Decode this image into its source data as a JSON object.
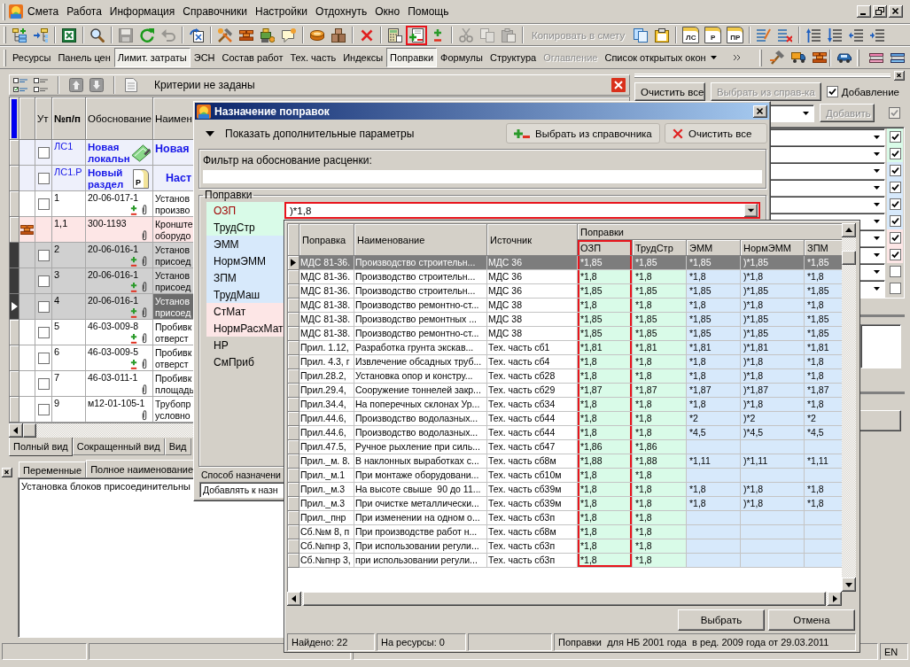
{
  "menu": {
    "items": [
      "Смета",
      "Работа",
      "Информация",
      "Справочники",
      "Настройки",
      "Отдохнуть",
      "Окно",
      "Помощь"
    ]
  },
  "toolbar": [
    [
      {
        "kind": "icon",
        "disabled": false,
        "highlighted": false
      },
      {
        "kind": "icon",
        "disabled": false,
        "highlighted": false
      }
    ],
    [
      {
        "kind": "icon",
        "disabled": false,
        "highlighted": false
      }
    ],
    [
      {
        "kind": "icon",
        "disabled": false,
        "highlighted": false
      }
    ],
    [
      {
        "kind": "icon",
        "disabled": true,
        "highlighted": false
      },
      {
        "kind": "icon",
        "disabled": false,
        "highlighted": false
      },
      {
        "kind": "icon",
        "disabled": true,
        "highlighted": false
      }
    ],
    [
      {
        "kind": "icon",
        "disabled": false,
        "highlighted": false
      }
    ],
    [
      {
        "kind": "icon",
        "disabled": false,
        "highlighted": false
      },
      {
        "kind": "icon",
        "disabled": false,
        "highlighted": false
      },
      {
        "kind": "icon",
        "disabled": false,
        "highlighted": false
      },
      {
        "kind": "icon",
        "disabled": false,
        "highlighted": false
      }
    ],
    [
      {
        "kind": "icon",
        "disabled": false,
        "highlighted": false
      },
      {
        "kind": "icon",
        "disabled": false,
        "highlighted": false
      }
    ],
    [
      {
        "kind": "icon",
        "disabled": false,
        "highlighted": false
      }
    ],
    [
      {
        "kind": "icon",
        "disabled": false,
        "highlighted": false
      },
      {
        "kind": "icon",
        "disabled": false,
        "highlighted": true
      },
      {
        "kind": "icon",
        "disabled": false,
        "highlighted": false
      }
    ],
    [
      {
        "kind": "icon",
        "disabled": true,
        "highlighted": false
      },
      {
        "kind": "icon",
        "disabled": true,
        "highlighted": false
      },
      {
        "kind": "icon",
        "disabled": true,
        "highlighted": false
      }
    ],
    [
      {
        "kind": "text",
        "label": "Копировать в смету",
        "disabled": true,
        "highlighted": false
      },
      {
        "kind": "icon",
        "disabled": false,
        "highlighted": false
      },
      {
        "kind": "icon",
        "disabled": false,
        "highlighted": false
      }
    ],
    [
      {
        "kind": "form",
        "label": "ЛС",
        "disabled": false,
        "highlighted": false
      },
      {
        "kind": "form",
        "label": "Р",
        "disabled": false,
        "highlighted": false
      },
      {
        "kind": "form",
        "label": "ПР",
        "disabled": false,
        "highlighted": false
      }
    ],
    [
      {
        "kind": "icon",
        "disabled": false,
        "highlighted": false
      },
      {
        "kind": "icon",
        "disabled": false,
        "highlighted": false
      }
    ],
    [
      {
        "kind": "icon",
        "disabled": false,
        "highlighted": false
      },
      {
        "kind": "icon",
        "disabled": false,
        "highlighted": false
      },
      {
        "kind": "icon",
        "disabled": false,
        "highlighted": false
      },
      {
        "kind": "icon",
        "disabled": false,
        "highlighted": false
      }
    ]
  ],
  "panel_tabs": [
    {
      "kind": "toggle",
      "label": "Ресурсы",
      "selected": false,
      "disabled": false
    },
    {
      "kind": "toggle",
      "label": "Панель цен",
      "selected": false,
      "disabled": false
    },
    {
      "kind": "toggle",
      "label": "Лимит. затраты",
      "selected": true,
      "disabled": false
    },
    {
      "kind": "toggle",
      "label": "ЭСН",
      "selected": false,
      "disabled": false
    },
    {
      "kind": "toggle",
      "label": "Состав работ",
      "selected": false,
      "disabled": false
    },
    {
      "kind": "toggle",
      "label": "Тех. часть",
      "selected": false,
      "disabled": false
    },
    {
      "kind": "toggle",
      "label": "Индексы",
      "selected": false,
      "disabled": false
    },
    {
      "kind": "toggle",
      "label": "Поправки",
      "selected": true,
      "disabled": false
    },
    {
      "kind": "toggle",
      "label": "Формулы",
      "selected": false,
      "disabled": false
    },
    {
      "kind": "toggle",
      "label": "Структура",
      "selected": false,
      "disabled": false
    },
    {
      "kind": "toggle",
      "label": "Оглавление",
      "selected": false,
      "disabled": true
    },
    {
      "kind": "menu",
      "label": "Список открытых окон",
      "selected": false,
      "disabled": false
    }
  ],
  "estimate": {
    "filter_status": "Критерии не заданы",
    "move_buttons": [
      {
        "disabled": true
      },
      {
        "disabled": true
      }
    ],
    "columns": [
      "Ут",
      "№п/п",
      "Обоснование",
      "Наимен"
    ],
    "rows": [
      {
        "kind": "estimate",
        "number": "ЛС1",
        "code": "Новая локальн",
        "name": "Новая",
        "checked": false,
        "selected": false,
        "current": false
      },
      {
        "kind": "section",
        "number": "ЛС1.Р",
        "code": "Новый раздел",
        "badge": "Р",
        "name": "Наст",
        "checked": false,
        "selected": false,
        "current": false
      },
      {
        "kind": "item",
        "number": "1",
        "code": "20-06-017-1",
        "name": "Установ произво",
        "checked": false,
        "has_adjustments": true,
        "selected": false,
        "current": false
      },
      {
        "kind": "resource",
        "number": "1,1",
        "code": "300-1193",
        "name": "Кронште оборудо",
        "has_adjustments": false,
        "selected": false,
        "current": false
      },
      {
        "kind": "item",
        "number": "2",
        "code": "20-06-016-1",
        "name": "Установ присоед",
        "checked": false,
        "has_adjustments": true,
        "selected": true,
        "current": false
      },
      {
        "kind": "item",
        "number": "3",
        "code": "20-06-016-1",
        "name": "Установ присоед",
        "checked": false,
        "has_adjustments": true,
        "selected": true,
        "current": false
      },
      {
        "kind": "item",
        "number": "4",
        "code": "20-06-016-1",
        "name": "Установ присоед",
        "checked": false,
        "has_adjustments": true,
        "selected": true,
        "current": true
      },
      {
        "kind": "item",
        "number": "5",
        "code": "46-03-009-8",
        "name": "Пробивк отверст",
        "checked": false,
        "has_adjustments": true,
        "selected": false,
        "current": false
      },
      {
        "kind": "item",
        "number": "6",
        "code": "46-03-009-5",
        "name": "Пробивк отверст",
        "checked": false,
        "has_adjustments": true,
        "selected": false,
        "current": false
      },
      {
        "kind": "item",
        "number": "7",
        "code": "46-03-011-1",
        "name": "Пробивк площадь",
        "checked": false,
        "has_adjustments": false,
        "selected": false,
        "current": false
      },
      {
        "kind": "item",
        "number": "9",
        "code": "м12-01-105-1",
        "name": "Трубопр условно",
        "checked": false,
        "has_adjustments": false,
        "selected": false,
        "current": false
      }
    ],
    "view_tabs": [
      {
        "label": "Полный вид",
        "selected": true
      },
      {
        "label": "Сокращенный вид",
        "selected": false
      },
      {
        "label": "Вид",
        "selected": false
      }
    ]
  },
  "details": {
    "tabs": [
      {
        "label": "Переменные",
        "selected": false
      },
      {
        "label": "Полное наименование",
        "selected": true
      }
    ],
    "text": "Установка блоков присоединительны"
  },
  "side_panel": {
    "clear_button": "Очистить все",
    "pick_button": {
      "label": "Выбрать из справ-ка",
      "disabled": true
    },
    "append": {
      "label": "Добавление",
      "checked": true
    },
    "add_button": {
      "label": "Добавить",
      "disabled": true
    },
    "add_check": {
      "checked": true,
      "disabled": true
    },
    "rows": [
      {
        "checked": true,
        "color": "#d9fbe8"
      },
      {
        "checked": true,
        "color": "#d9fbe8"
      },
      {
        "checked": true,
        "color": "#d7e9fb"
      },
      {
        "checked": true,
        "color": "#d7e9fb"
      },
      {
        "checked": true,
        "color": "#d7e9fb"
      },
      {
        "checked": true,
        "color": "#d7e9fb"
      },
      {
        "checked": true,
        "color": "#fde6e6"
      },
      {
        "checked": true,
        "color": "#fde6e6"
      },
      {
        "checked": false
      },
      {
        "checked": false
      }
    ]
  },
  "dialog": {
    "title": "Назначение поправок",
    "options_toggle": "Показать дополнительные параметры",
    "pick_button": "Выбрать из справочника",
    "clear_button": "Очистить все",
    "filter_label": "Фильтр на обоснование расценки:",
    "group_title": "Поправки",
    "items": [
      {
        "label": "ОЗП",
        "selected": true,
        "color": "#d9fbe8"
      },
      {
        "label": "ТрудСтр",
        "selected": false,
        "color": "#d9fbe8"
      },
      {
        "label": "ЭММ",
        "selected": false,
        "color": "#d7e9fb"
      },
      {
        "label": "НормЭММ",
        "selected": false,
        "color": "#d7e9fb"
      },
      {
        "label": "ЗПМ",
        "selected": false,
        "color": "#d7e9fb"
      },
      {
        "label": "ТрудМаш",
        "selected": false,
        "color": "#d7e9fb"
      },
      {
        "label": "СтМат",
        "selected": false,
        "color": "#fde6e6"
      },
      {
        "label": "НормРасхМат",
        "selected": false,
        "color": "#fde6e6"
      },
      {
        "label": "НР",
        "selected": false
      },
      {
        "label": "СмПриб",
        "selected": false
      }
    ],
    "value": {
      "text": ")*1,8",
      "highlighted": true
    },
    "mode_label": "Способ назначени",
    "mode_value": "Добавлять к назн"
  },
  "popup": {
    "columns": [
      "Поправка",
      "Наименование",
      "Источник"
    ],
    "group_header": "Поправки",
    "coef_columns": [
      {
        "label": "ОЗП",
        "color": "#d9fbe8",
        "highlighted": true
      },
      {
        "label": "ТрудСтр",
        "color": "#d9fbe8",
        "highlighted": false
      },
      {
        "label": "ЭММ",
        "color": "#d7e9fb",
        "highlighted": false
      },
      {
        "label": "НормЭММ",
        "color": "#d7e9fb",
        "highlighted": false
      },
      {
        "label": "ЗПМ",
        "color": "#d7e9fb",
        "highlighted": false
      }
    ],
    "rows": [
      {
        "selected": true,
        "cells": [
          "МДС 81-36.",
          "Производство строительн...",
          "МДС 36",
          "*1,85",
          "*1,85",
          "*1,85",
          ")*1,85",
          "*1,85"
        ]
      },
      {
        "selected": false,
        "cells": [
          "МДС 81-36.",
          "Производство строительн...",
          "МДС 36",
          "*1,8",
          "*1,8",
          "*1,8",
          ")*1,8",
          "*1,8"
        ]
      },
      {
        "selected": false,
        "cells": [
          "МДС 81-36.",
          "Производство строительн...",
          "МДС 36",
          "*1,85",
          "*1,85",
          "*1,85",
          ")*1,85",
          "*1,85"
        ]
      },
      {
        "selected": false,
        "cells": [
          "МДС 81-38.",
          "Производство ремонтно-ст...",
          "МДС 38",
          "*1,8",
          "*1,8",
          "*1,8",
          ")*1,8",
          "*1,8"
        ]
      },
      {
        "selected": false,
        "cells": [
          "МДС 81-38.",
          "Производство ремонтных ...",
          "МДС 38",
          "*1,85",
          "*1,85",
          "*1,85",
          ")*1,85",
          "*1,85"
        ]
      },
      {
        "selected": false,
        "cells": [
          "МДС 81-38.",
          "Производство ремонтно-ст...",
          "МДС 38",
          "*1,85",
          "*1,85",
          "*1,85",
          ")*1,85",
          "*1,85"
        ]
      },
      {
        "selected": false,
        "cells": [
          "Прил. 1.12,",
          "Разработка грунта экскав...",
          "Тех. часть сб1",
          "*1,81",
          "*1,81",
          "*1,81",
          ")*1,81",
          "*1,81"
        ]
      },
      {
        "selected": false,
        "cells": [
          "Прил. 4.3, г",
          "Извлечение обсадных труб...",
          "Тех. часть сб4",
          "*1,8",
          "*1,8",
          "*1,8",
          ")*1,8",
          "*1,8"
        ]
      },
      {
        "selected": false,
        "cells": [
          "Прил.28.2,",
          "Установка опор и констру...",
          "Тех. часть сб28",
          "*1,8",
          "*1,8",
          "*1,8",
          ")*1,8",
          "*1,8"
        ]
      },
      {
        "selected": false,
        "cells": [
          "Прил.29.4,",
          "Сооружение тоннелей закр...",
          "Тех. часть сб29",
          "*1,87",
          "*1,87",
          "*1,87",
          ")*1,87",
          "*1,87"
        ]
      },
      {
        "selected": false,
        "cells": [
          "Прил.34.4,",
          "На поперечных склонах Ур...",
          "Тех. часть сб34",
          "*1,8",
          "*1,8",
          "*1,8",
          ")*1,8",
          "*1,8"
        ]
      },
      {
        "selected": false,
        "cells": [
          "Прил.44.6,",
          "Производство водолазных...",
          "Тех. часть сб44",
          "*1,8",
          "*1,8",
          "*2",
          ")*2",
          "*2"
        ]
      },
      {
        "selected": false,
        "cells": [
          "Прил.44.6,",
          "Производство водолазных...",
          "Тех. часть сб44",
          "*1,8",
          "*1,8",
          "*4,5",
          ")*4,5",
          "*4,5"
        ]
      },
      {
        "selected": false,
        "cells": [
          "Прил.47.5,",
          "Ручное рыхление при силь...",
          "Тех. часть сб47",
          "*1,86",
          "*1,86"
        ]
      },
      {
        "selected": false,
        "cells": [
          "Прил._м. 8.",
          "В наклонных выработках с...",
          "Тех. часть сб8м",
          "*1,88",
          "*1,88",
          "*1,11",
          ")*1,11",
          "*1,11"
        ]
      },
      {
        "selected": false,
        "cells": [
          "Прил._м.1",
          "При монтаже оборудовани...",
          "Тех. часть сб10м",
          "*1,8",
          "*1,8"
        ]
      },
      {
        "selected": false,
        "cells": [
          "Прил._м.3",
          "На высоте свыше  90 до 11...",
          "Тех. часть сб39м",
          "*1,8",
          "*1,8",
          "*1,8",
          ")*1,8",
          "*1,8"
        ]
      },
      {
        "selected": false,
        "cells": [
          "Прил._м.3",
          "При очистке металлически...",
          "Тех. часть сб39м",
          "*1,8",
          "*1,8",
          "*1,8",
          ")*1,8",
          "*1,8"
        ]
      },
      {
        "selected": false,
        "cells": [
          "Прил._пнр",
          "При изменении на одном о...",
          "Тех. часть сб3п",
          "*1,8",
          "*1,8"
        ]
      },
      {
        "selected": false,
        "cells": [
          "Сб.№м 8, п",
          "При производстве работ н...",
          "Тех. часть сб8м",
          "*1,8",
          "*1,8"
        ]
      },
      {
        "selected": false,
        "cells": [
          "Сб.№пнр 3,",
          "При использовании регули...",
          "Тех. часть сб3п",
          "*1,8",
          "*1,8"
        ]
      },
      {
        "selected": false,
        "cells": [
          "Сб.№пнр 3,",
          "при использовании регули...",
          "Тех. часть сб3п",
          "*1,8",
          "*1,8"
        ]
      }
    ],
    "buttons": [
      "Выбрать",
      "Отмена"
    ],
    "status": [
      "Найдено: 22",
      "На ресурсы: 0",
      "Поправки  для НБ 2001 года  в ред. 2009 года от 29.03.2011"
    ]
  },
  "status_bar": {
    "language": "EN"
  }
}
